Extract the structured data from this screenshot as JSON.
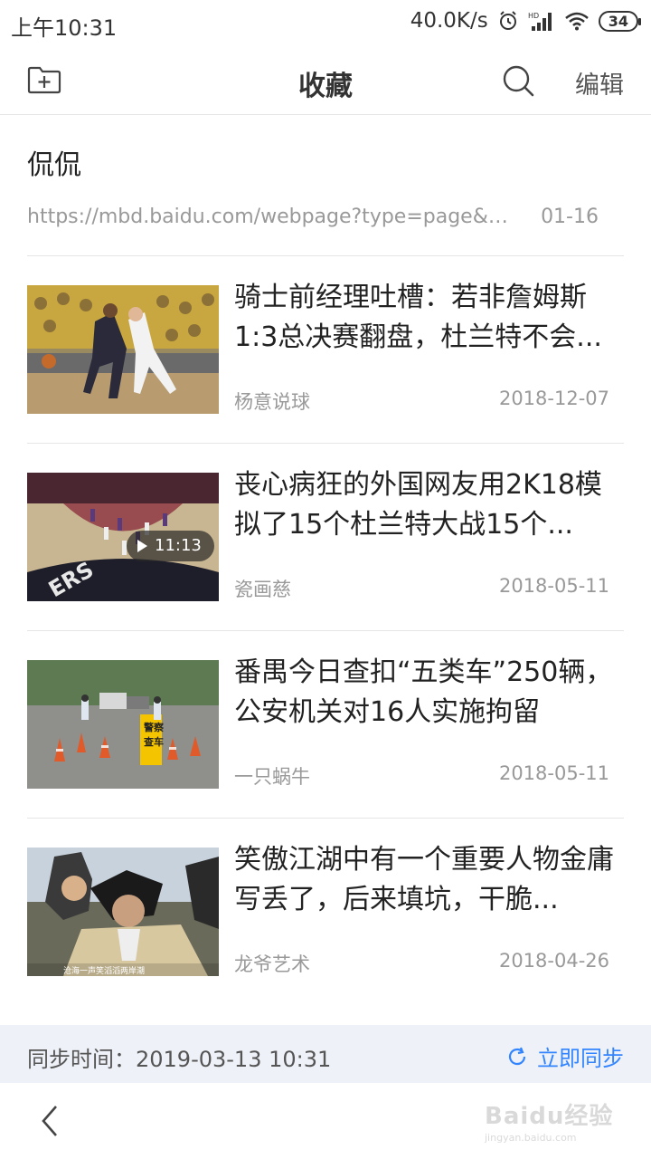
{
  "status_bar": {
    "time": "上午10:31",
    "speed": "40.0K/s",
    "battery": "34",
    "icons": [
      "alarm-icon",
      "signal-icon",
      "wifi-icon",
      "battery-icon"
    ]
  },
  "header": {
    "title": "收藏",
    "edit_label": "编辑",
    "icons": [
      "add-folder-icon",
      "search-icon"
    ]
  },
  "first_item": {
    "title": "侃侃",
    "url": "https://mbd.baidu.com/webpage?type=page&actio...",
    "date": "01-16"
  },
  "items": [
    {
      "title": "骑士前经理吐槽：若非詹姆斯1:3总决赛翻盘，杜兰特不会...",
      "source": "杨意说球",
      "date": "2018-12-07"
    },
    {
      "title": "丧心病狂的外国网友用2K18模拟了15个杜兰特大战15个...",
      "source": "瓷画慈",
      "date": "2018-05-11",
      "video_duration": "11:13"
    },
    {
      "title": "番禺今日查扣“五类车”250辆，公安机关对16人实施拘留",
      "source": "一只蜗牛",
      "date": "2018-05-11",
      "thumb_caption": "警察查车"
    },
    {
      "title": "笑傲江湖中有一个重要人物金庸写丢了，后来填坑，干脆...",
      "source": "龙爷艺术",
      "date": "2018-04-26",
      "thumb_caption": "沧海一声笑滔滔两岸潮"
    }
  ],
  "sync": {
    "time_text": "同步时间：2019-03-13 10:31",
    "button_label": "立即同步"
  },
  "footer": {
    "watermark": "Baidu经验",
    "watermark_url": "jingyan.baidu.com"
  },
  "colors": {
    "accent": "#3385ff",
    "sync_bg": "#eef2f8",
    "divider": "#e6e6e6"
  }
}
